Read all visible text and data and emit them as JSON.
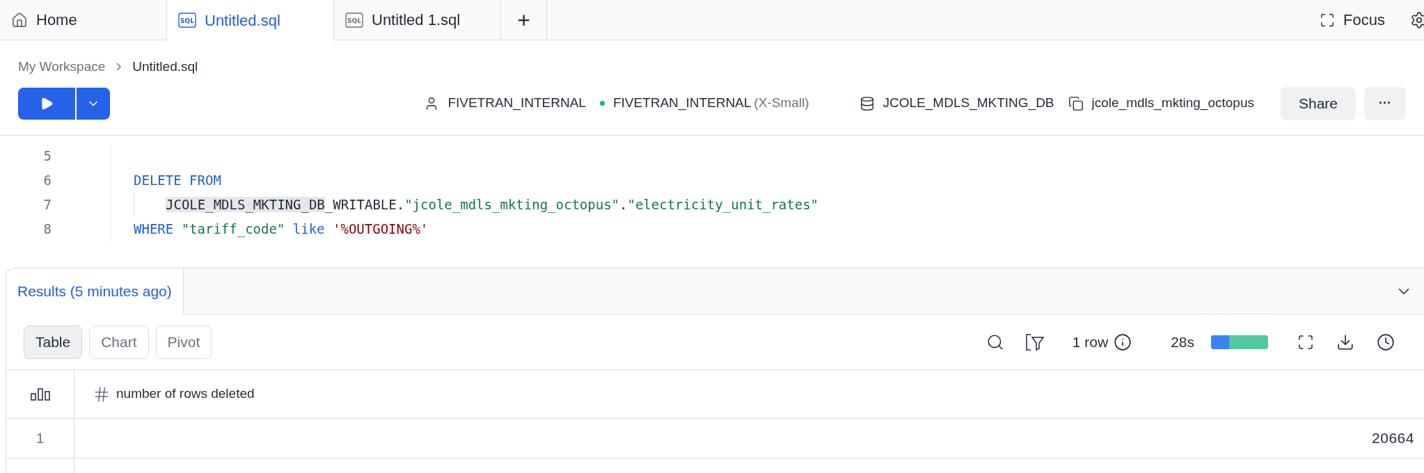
{
  "tabs": [
    {
      "label": "Home",
      "kind": "home",
      "selected": false
    },
    {
      "label": "Untitled.sql",
      "kind": "sql",
      "icon_text": "SQL",
      "selected": true
    },
    {
      "label": "Untitled 1.sql",
      "kind": "sql",
      "icon_text": "SQL",
      "selected": false
    }
  ],
  "new_tab": "+",
  "focus_button": "Focus",
  "breadcrumb": [
    "My Workspace",
    "Untitled.sql"
  ],
  "context": {
    "role": "FIVETRAN_INTERNAL",
    "warehouse": "FIVETRAN_INTERNAL",
    "warehouse_size": "(X-Small)",
    "database": "JCOLE_MDLS_MKTING_DB",
    "schema": "jcole_mdls_mkting_octopus"
  },
  "share_button": "Share",
  "more_button": "···",
  "code_lines": [
    {
      "number": "5",
      "indent": false
    },
    {
      "number": "6",
      "indent": false,
      "tokens": [
        {
          "kind": "keyword",
          "text": "DELETE FROM"
        }
      ]
    },
    {
      "number": "7",
      "indent": true,
      "tokens": [
        {
          "kind": "highlight",
          "text": "JCOLE_MDLS_MKTING_DB"
        },
        {
          "kind": "plain",
          "text": "_WRITABLE."
        },
        {
          "kind": "string",
          "text": "\"jcole_mdls_mkting_octopus\""
        },
        {
          "kind": "plain",
          "text": "."
        },
        {
          "kind": "string",
          "text": "\"electricity_unit_rates\""
        }
      ]
    },
    {
      "number": "8",
      "indent": false,
      "tokens": [
        {
          "kind": "keyword",
          "text": "WHERE "
        },
        {
          "kind": "string",
          "text": "\"tariff_code\""
        },
        {
          "kind": "keyword",
          "text": " like "
        },
        {
          "kind": "literal",
          "text": "'%OUTGOING%'"
        }
      ]
    }
  ],
  "results": {
    "tab": "Results (5 minutes ago)",
    "views": [
      {
        "label": "Table",
        "selected": true
      },
      {
        "label": "Chart",
        "selected": false
      },
      {
        "label": "Pivot",
        "selected": false
      }
    ],
    "row_count": "1 row",
    "duration": "28s",
    "level": 0.32,
    "columns": [
      "number of rows deleted"
    ],
    "rows": [
      {
        "index": "1",
        "cells": [
          "20664"
        ]
      }
    ]
  }
}
